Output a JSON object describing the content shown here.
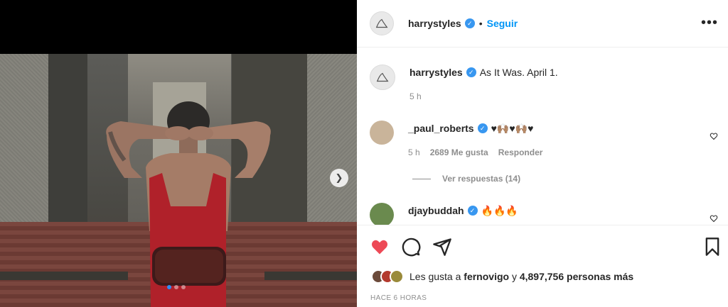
{
  "post": {
    "username": "harrystyles",
    "separator": "•",
    "follow_label": "Seguir",
    "more_label": "•••"
  },
  "caption": {
    "username": "harrystyles",
    "text": "As It Was. April 1.",
    "time": "5 h"
  },
  "comments": [
    {
      "username": "_paul_roberts",
      "text": "♥🙌🏽♥🙌🏽♥",
      "time": "5 h",
      "likes": "2689 Me gusta",
      "reply_label": "Responder",
      "view_replies": "Ver respuestas (14)",
      "avatar_color": "#c9b49a"
    },
    {
      "username": "djaybuddah",
      "text": "🔥🔥🔥",
      "avatar_color": "#6a8a4e"
    }
  ],
  "likes": {
    "prefix": "Les gusta a",
    "user": "fernovigo",
    "joiner": "y",
    "count": "4,897,756 personas más",
    "avatar_colors": [
      "#6b4a3a",
      "#b33a2e",
      "#9a8a3a"
    ]
  },
  "posted_label": "HACE 6 HORAS",
  "carousel": {
    "slide_index": 0,
    "slide_count": 3,
    "next_icon": "chevron-right-icon"
  },
  "colors": {
    "accent": "#0095f6",
    "like": "#ed4956",
    "verified": "#3897f0"
  }
}
